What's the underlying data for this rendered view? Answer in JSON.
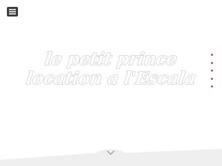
{
  "header": {
    "menu_icon": "hamburger-menu-icon"
  },
  "hero": {
    "title_line1": "le petit prince",
    "title_line2": "location a l'Escala"
  },
  "slider": {
    "dot_count": 5,
    "dot_color": "#d24a3a"
  },
  "footer": {
    "scroll_icon": "chevron-down-icon",
    "band_color": "#efefef"
  }
}
